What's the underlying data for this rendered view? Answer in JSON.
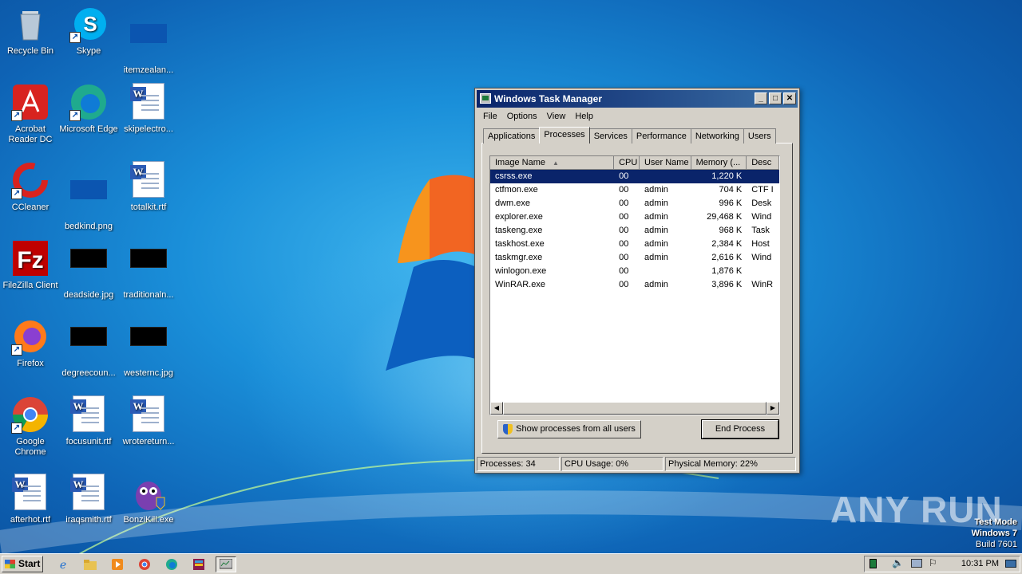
{
  "desktop": {
    "icons": [
      {
        "label": "Recycle Bin"
      },
      {
        "label": "Skype"
      },
      {
        "label": "itemzealan..."
      },
      {
        "label": "Acrobat Reader DC"
      },
      {
        "label": "Microsoft Edge"
      },
      {
        "label": "skipelectro..."
      },
      {
        "label": "CCleaner"
      },
      {
        "label": "bedkind.png"
      },
      {
        "label": "totalkit.rtf"
      },
      {
        "label": "FileZilla Client"
      },
      {
        "label": "deadside.jpg"
      },
      {
        "label": "traditionaln..."
      },
      {
        "label": "Firefox"
      },
      {
        "label": "degreecoun..."
      },
      {
        "label": "westernc.jpg"
      },
      {
        "label": "Google Chrome"
      },
      {
        "label": "focusunit.rtf"
      },
      {
        "label": "wrotereturn..."
      },
      {
        "label": "afterhot.rtf"
      },
      {
        "label": "iraqsmith.rtf"
      },
      {
        "label": "BonziKill.exe"
      }
    ]
  },
  "window": {
    "title": "Windows Task Manager",
    "menu": [
      "File",
      "Options",
      "View",
      "Help"
    ],
    "tabs": [
      "Applications",
      "Processes",
      "Services",
      "Performance",
      "Networking",
      "Users"
    ],
    "active_tab": "Processes",
    "columns": [
      "Image Name",
      "CPU",
      "User Name",
      "Memory (...",
      "Desc"
    ],
    "rows": [
      {
        "name": "csrss.exe",
        "cpu": "00",
        "user": "",
        "mem": "1,220 K",
        "desc": ""
      },
      {
        "name": "ctfmon.exe",
        "cpu": "00",
        "user": "admin",
        "mem": "704 K",
        "desc": "CTF I"
      },
      {
        "name": "dwm.exe",
        "cpu": "00",
        "user": "admin",
        "mem": "996 K",
        "desc": "Desk"
      },
      {
        "name": "explorer.exe",
        "cpu": "00",
        "user": "admin",
        "mem": "29,468 K",
        "desc": "Wind"
      },
      {
        "name": "taskeng.exe",
        "cpu": "00",
        "user": "admin",
        "mem": "968 K",
        "desc": "Task"
      },
      {
        "name": "taskhost.exe",
        "cpu": "00",
        "user": "admin",
        "mem": "2,384 K",
        "desc": "Host"
      },
      {
        "name": "taskmgr.exe",
        "cpu": "00",
        "user": "admin",
        "mem": "2,616 K",
        "desc": "Wind"
      },
      {
        "name": "winlogon.exe",
        "cpu": "00",
        "user": "",
        "mem": "1,876 K",
        "desc": ""
      },
      {
        "name": "WinRAR.exe",
        "cpu": "00",
        "user": "admin",
        "mem": "3,896 K",
        "desc": "WinR"
      }
    ],
    "show_all_label": "Show processes from all users",
    "end_process_label": "End Process",
    "status": {
      "processes": "Processes: 34",
      "cpu": "CPU Usage: 0%",
      "memory": "Physical Memory: 22%"
    }
  },
  "taskbar": {
    "start_label": "Start",
    "clock": "10:31 PM"
  },
  "watermark": {
    "line1": "Test Mode",
    "line2": "Windows 7",
    "line3": "Build 7601",
    "brand": "ANY RUN"
  }
}
